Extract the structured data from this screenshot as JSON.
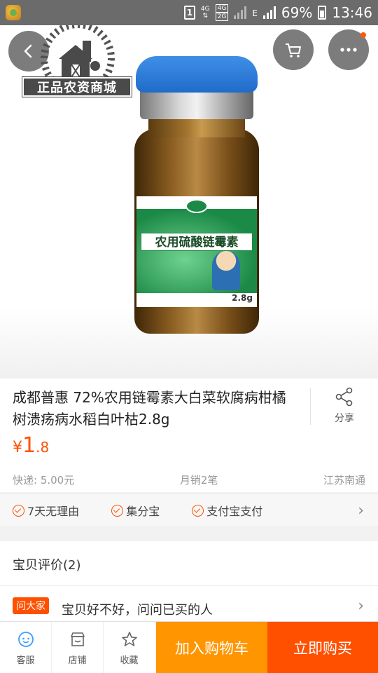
{
  "status_bar": {
    "sim": "1",
    "network_top": "4G",
    "network_box": "4G",
    "network_sub": "2G",
    "data_type": "E",
    "battery": "69%",
    "time": "13:46"
  },
  "hero": {
    "logo_text": "正品农资商城",
    "bottle_label": "农用硫酸链霉素",
    "bottle_weight": "2.8g"
  },
  "product": {
    "title": "成都普惠 72%农用链霉素大白菜软腐病柑橘树溃疡病水稻白叶枯2.8g",
    "share_label": "分享",
    "price_symbol": "¥",
    "price_int": "1",
    "price_dec": ".8",
    "shipping": "快递: 5.00元",
    "monthly_sales": "月销2笔",
    "location": "江苏南通"
  },
  "services": [
    {
      "label": "7天无理由"
    },
    {
      "label": "集分宝"
    },
    {
      "label": "支付宝支付"
    }
  ],
  "reviews": {
    "label": "宝贝评价(2)"
  },
  "ask": {
    "badge": "问大家",
    "text": "宝贝好不好，问问已买的人"
  },
  "bottom_bar": {
    "service": "客服",
    "shop": "店铺",
    "favorite": "收藏",
    "add_to_cart": "加入购物车",
    "buy_now": "立即购买"
  },
  "colors": {
    "accent": "#ff5000",
    "add_cart": "#ff9500"
  }
}
